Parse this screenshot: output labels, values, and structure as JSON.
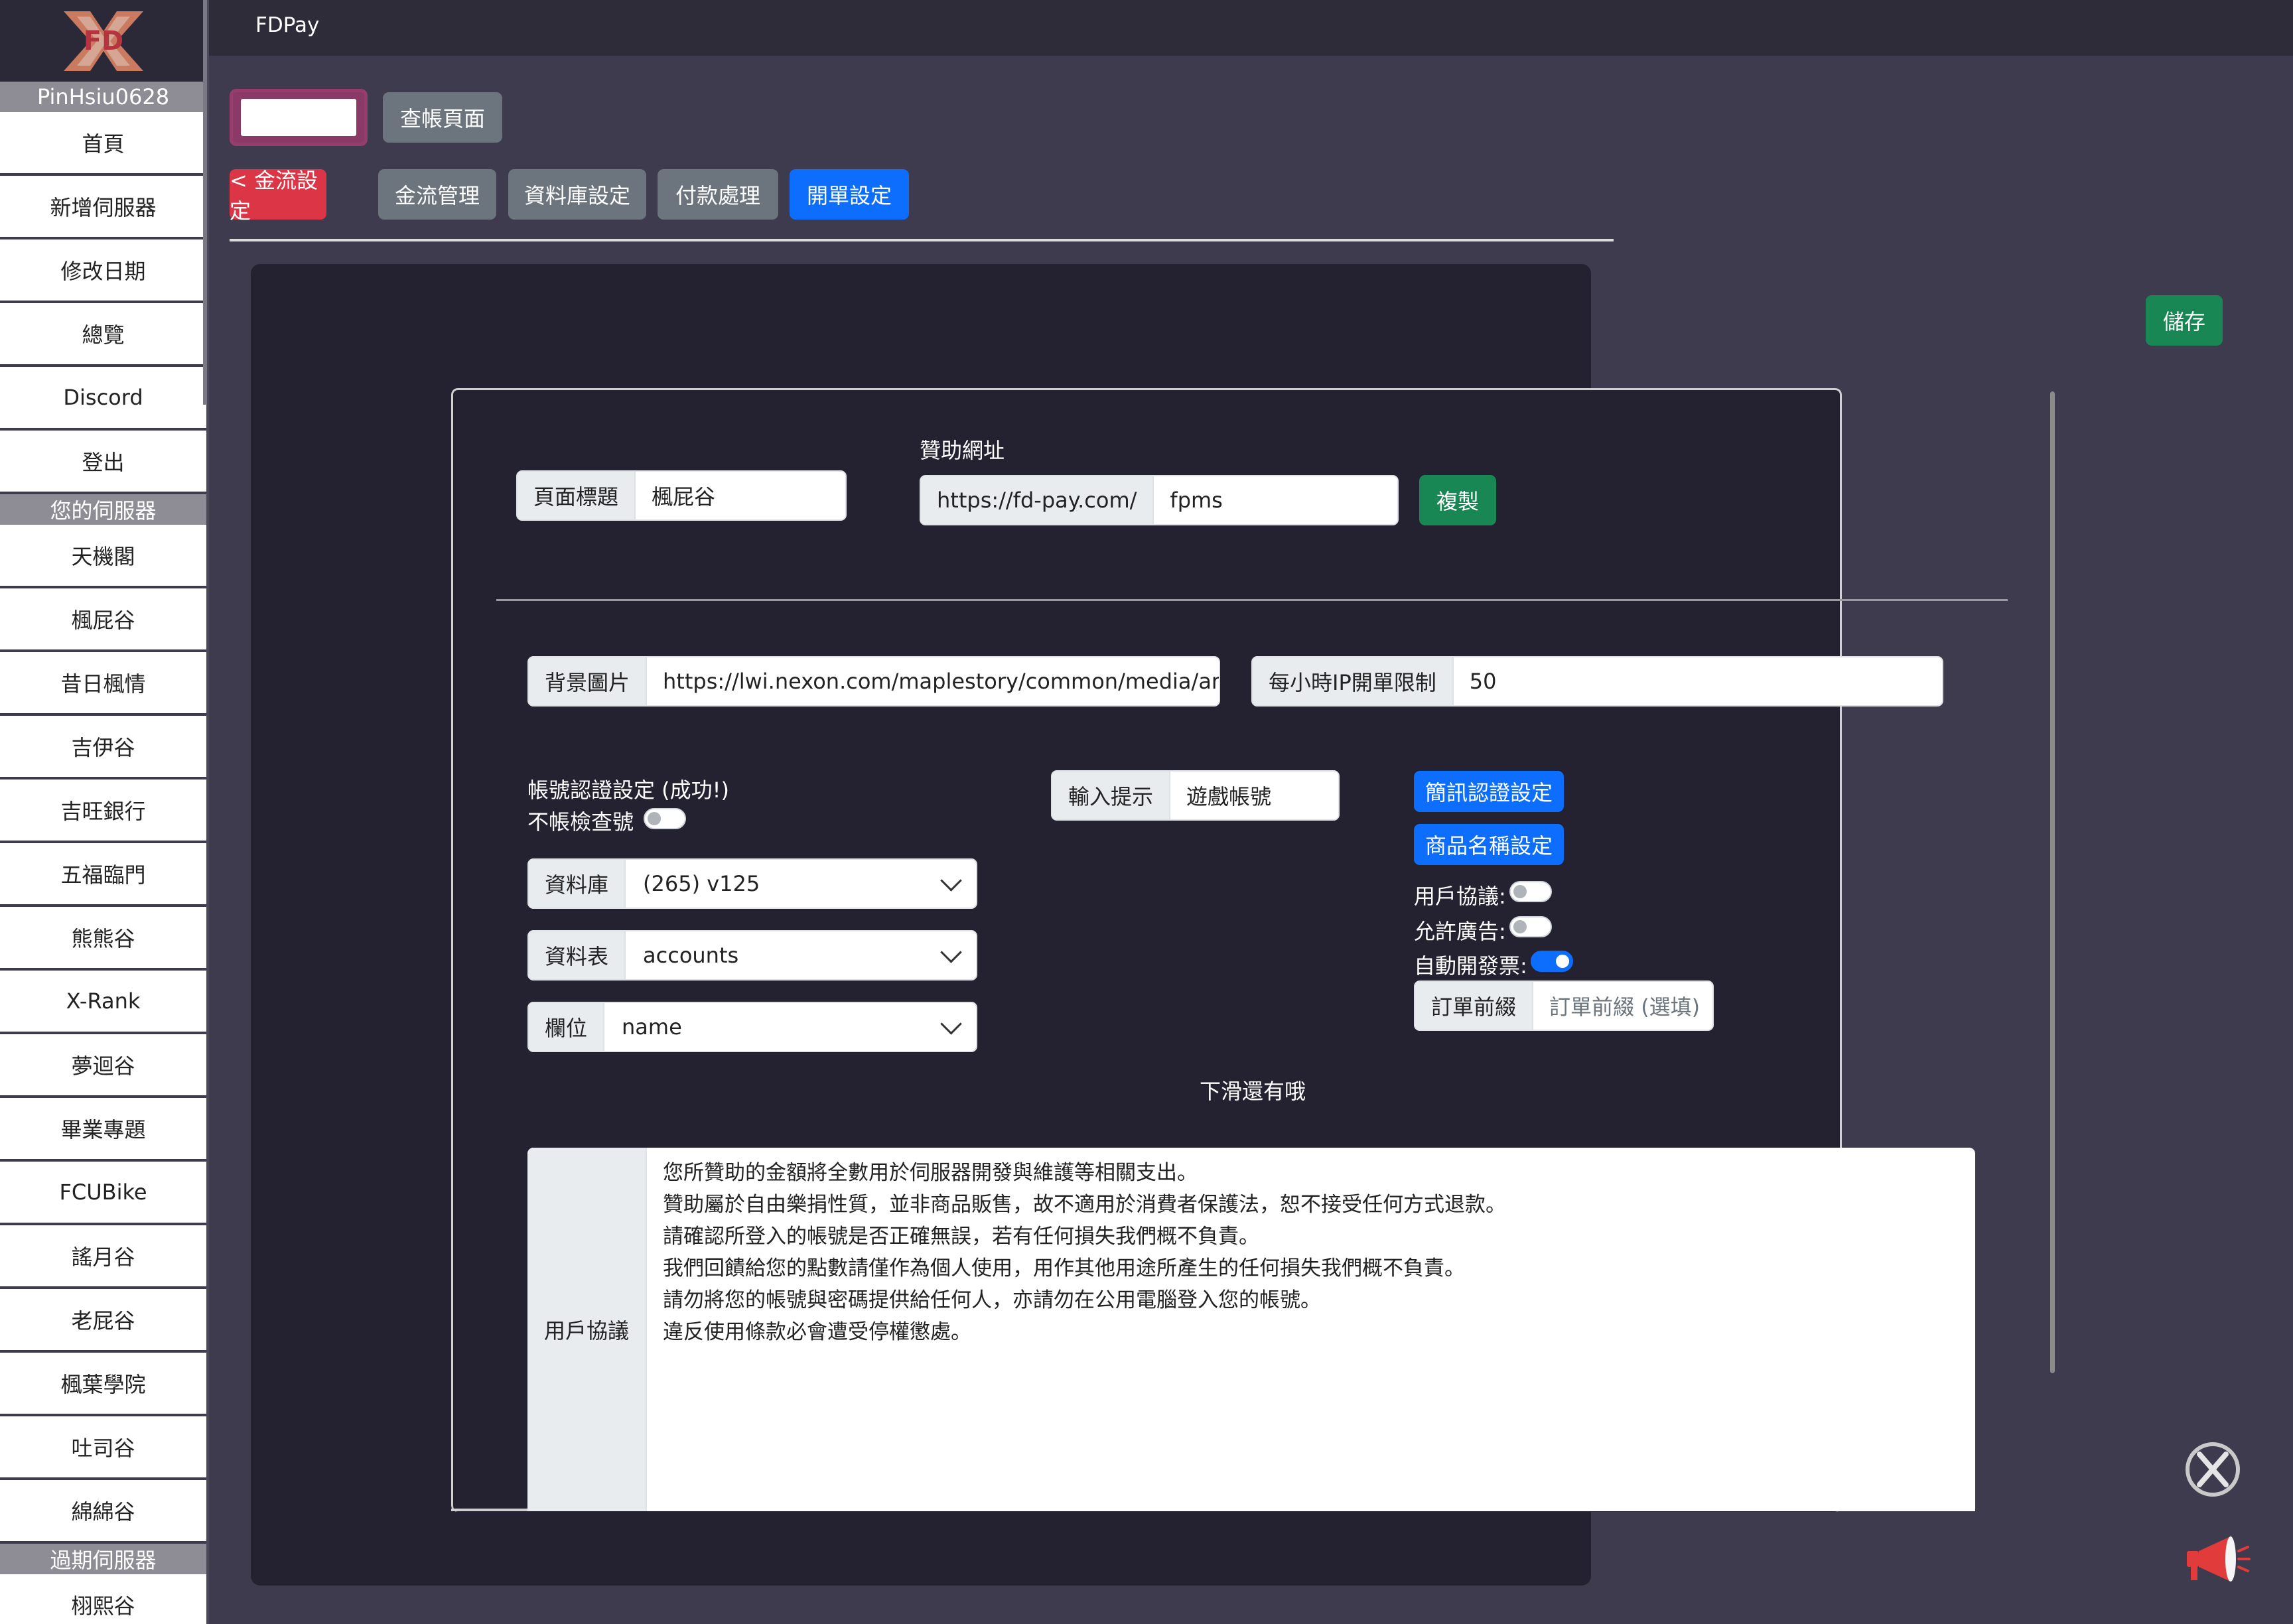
{
  "app": {
    "title": "FDPay"
  },
  "sidebar": {
    "username": "PinHsiu0628",
    "nav": [
      "首頁",
      "新增伺服器",
      "修改日期",
      "總覽",
      "Discord",
      "登出"
    ],
    "servers_header": "您的伺服器",
    "servers": [
      "天機閣",
      "楓屁谷",
      "昔日楓情",
      "吉伊谷",
      "吉旺銀行",
      "五福臨門",
      "熊熊谷",
      "X-Rank",
      "夢迴谷",
      "畢業專題",
      "FCUBike",
      "謠月谷",
      "老屁谷",
      "楓葉學院",
      "吐司谷",
      "綿綿谷"
    ],
    "expired_header": "過期伺服器",
    "expired": [
      "栩熙谷"
    ]
  },
  "toolbar": {
    "view_bill": "查帳頁面",
    "back": "< 金流設定",
    "manage": "金流管理",
    "db_settings": "資料庫設定",
    "payment": "付款處理",
    "order_settings": "開單設定"
  },
  "panel": {
    "save": "儲存",
    "page_title_label": "頁面標題",
    "page_title_value": "楓屁谷",
    "sponsor_url_heading": "贊助網址",
    "sponsor_url_prefix": "https://fd-pay.com/",
    "sponsor_url_value": "fpms",
    "copy": "複製",
    "bg_image_label": "背景圖片",
    "bg_image_value": "https://lwi.nexon.com/maplestory/common/media/artwor",
    "ip_limit_label": "每小時IP開單限制",
    "ip_limit_value": "50",
    "account_verify_heading": "帳號認證設定 (成功!)",
    "no_check_label": "不帳檢查號",
    "no_check_on": false,
    "database_label": "資料庫",
    "database_value": "(265) v125",
    "table_label": "資料表",
    "table_value": "accounts",
    "field_label": "欄位",
    "field_value": "name",
    "input_hint_label": "輸入提示",
    "input_hint_value": "遊戲帳號",
    "sms_button": "簡訊認證設定",
    "product_button": "商品名稱設定",
    "user_agreement_toggle": "用戶協議:",
    "user_agreement_on": false,
    "allow_ads_toggle": "允許廣告:",
    "allow_ads_on": false,
    "auto_invoice_toggle": "自動開發票:",
    "auto_invoice_on": true,
    "order_prefix_label": "訂單前綴",
    "order_prefix_placeholder": "訂單前綴 (選填)",
    "scroll_hint": "下滑還有哦",
    "agreement_label": "用戶協議",
    "agreement_lines": [
      "您所贊助的金額將全數用於伺服器開發與維護等相關支出。",
      "贊助屬於自由樂捐性質，並非商品販售，故不適用於消費者保護法，恕不接受任何方式退款。",
      "請確認所登入的帳號是否正確無誤，若有任何損失我們概不負責。",
      "我們回饋給您的點數請僅作為個人使用，用作其他用途所產生的任何損失我們概不負責。",
      "請勿將您的帳號與密碼提供給任何人，亦請勿在公用電腦登入您的帳號。",
      "違反使用條款必會遭受停權懲處。"
    ]
  },
  "colors": {
    "background": "#3d3b4d",
    "panel": "#242231",
    "danger": "#dc3545",
    "primary": "#0d6efd",
    "success": "#198754",
    "secondary": "#6c757d"
  },
  "icons": [
    "fd-logo-icon",
    "x-circle-icon",
    "megaphone-icon",
    "chevron-down-icon"
  ]
}
